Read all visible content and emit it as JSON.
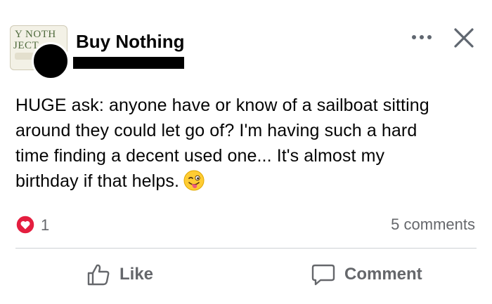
{
  "group": {
    "name": "Buy Nothing",
    "logo_text_line1": "Y NOTH",
    "logo_text_line2": "JECT"
  },
  "post": {
    "text_lines": [
      "HUGE ask: anyone have or know of a sailboat sitting",
      "around they could let go of? I'm having such a hard",
      "time finding a decent used one... It's almost my",
      "birthday if that helps."
    ],
    "emoji": "winking-face-with-tongue-icon"
  },
  "reactions": {
    "count": "1",
    "type": "love"
  },
  "comments": {
    "label": "5 comments"
  },
  "actions": {
    "like_label": "Like",
    "comment_label": "Comment"
  },
  "colors": {
    "love_red": "#e41e3f",
    "text_secondary": "#65676b",
    "divider": "#ced0d4"
  }
}
